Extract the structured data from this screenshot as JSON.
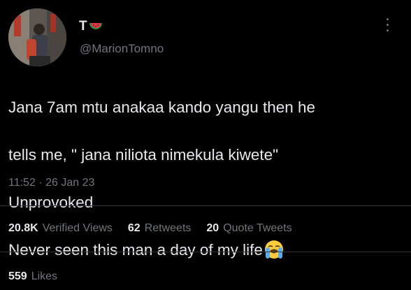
{
  "author": {
    "display_name": "T",
    "handle": "@MarionTomno",
    "name_emoji": "watermelon-emoji"
  },
  "tweet": {
    "lines": [
      "Jana 7am mtu anakaa kando yangu then he",
      "tells me, \" jana niliota nimekula kiwete\"",
      "Unprovoked",
      "Never seen this man a day of my life"
    ],
    "trailing_emoji": "loudly-crying-face-emoji"
  },
  "meta": {
    "time": "11:52",
    "separator": "·",
    "date": "26 Jan 23"
  },
  "stats": {
    "views_count": "20.8K",
    "views_label": "Verified Views",
    "retweets_count": "62",
    "retweets_label": "Retweets",
    "quotes_count": "20",
    "quotes_label": "Quote Tweets",
    "likes_count": "559",
    "likes_label": "Likes"
  },
  "colors": {
    "background": "#000000",
    "text": "#e7e9ea",
    "secondary": "#71767b",
    "divider": "#2f3336"
  }
}
